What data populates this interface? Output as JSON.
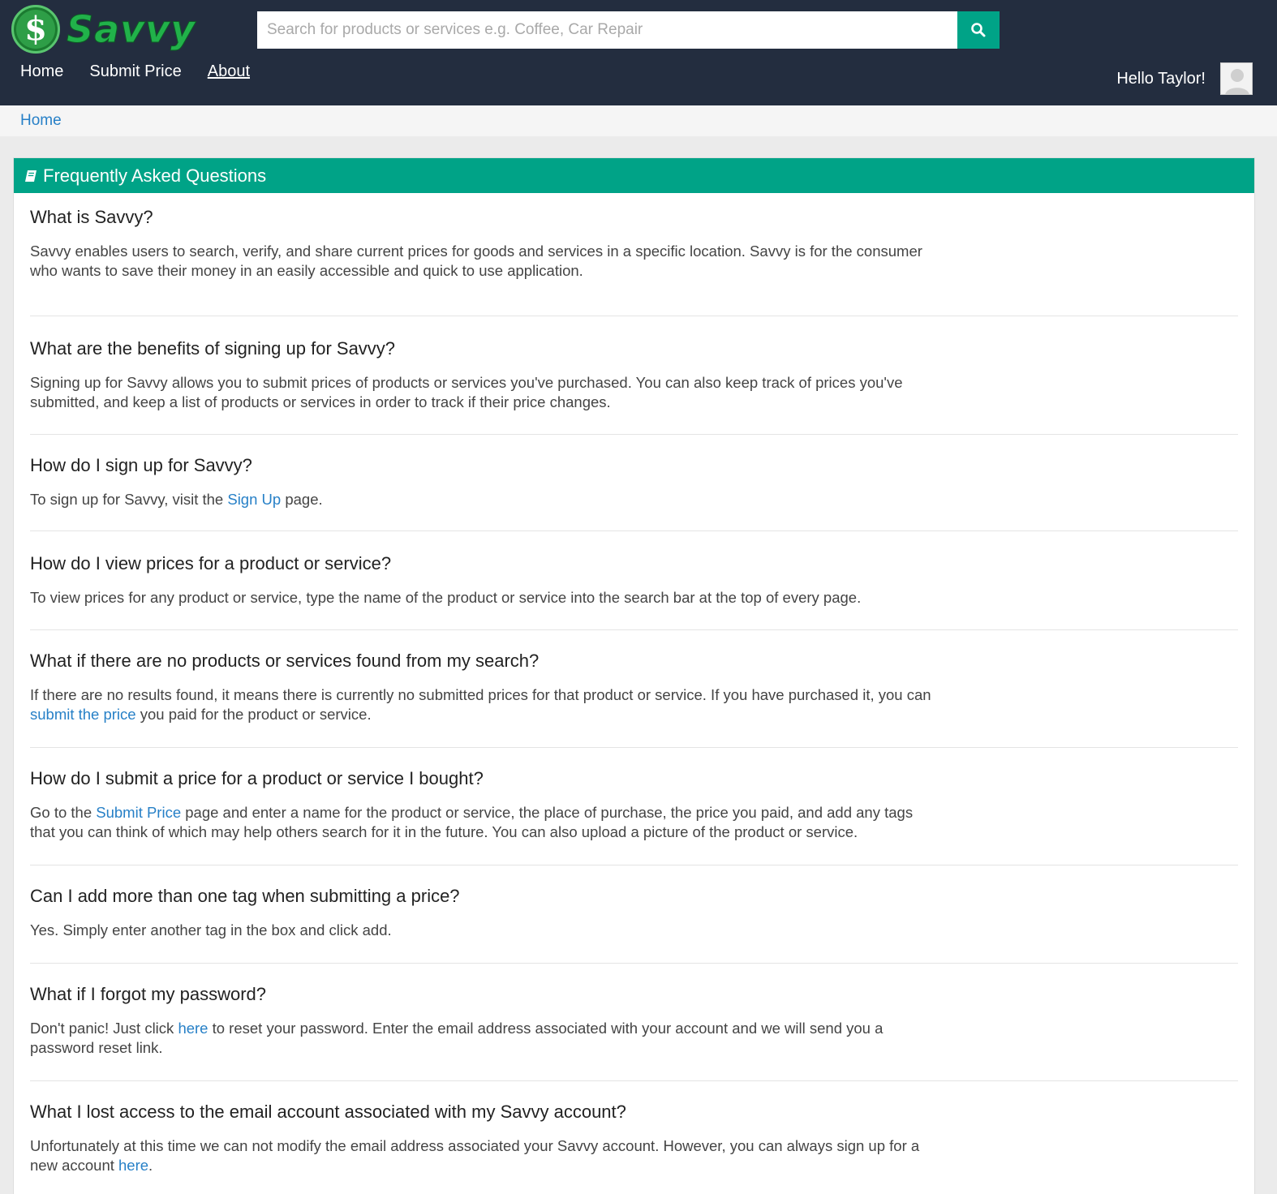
{
  "brand": {
    "name": "Savvy",
    "symbol": "$"
  },
  "search": {
    "placeholder": "Search for products or services e.g. Coffee, Car Repair",
    "button_icon": "search-icon"
  },
  "nav": {
    "items": [
      {
        "label": "Home"
      },
      {
        "label": "Submit Price"
      },
      {
        "label": "About"
      }
    ],
    "active": "About"
  },
  "user": {
    "greeting": "Hello Taylor!",
    "avatar_icon": "user-avatar-icon"
  },
  "breadcrumb": {
    "home": "Home"
  },
  "faq": {
    "title": "Frequently Asked Questions",
    "title_icon": "book-icon",
    "items": [
      {
        "q": "What is Savvy?",
        "a": [
          "Savvy enables users to search, verify, and share current prices for goods and services in a specific location. Savvy is for the consumer who wants to save their money in an easily accessible and quick to use application."
        ]
      },
      {
        "q": "What are the benefits of signing up for Savvy?",
        "a": [
          "Signing up for Savvy allows you to submit prices of products or services you've purchased. You can also keep track of prices you've submitted, and keep a list of products or services in order to track if their price changes."
        ]
      },
      {
        "q": "How do I sign up for Savvy?",
        "a": [
          "To sign up for Savvy, visit the ",
          "page."
        ],
        "link": "Sign Up"
      },
      {
        "q": "How do I view prices for a product or service?",
        "a": [
          "To view prices for any product or service, type the name of the product or service into the search bar at the top of every page."
        ]
      },
      {
        "q": "What if there are no products or services found from my search?",
        "a": [
          "If there are no results found, it means there is currently no submitted prices for that product or service. If you have purchased it, you can ",
          "you paid for the product or service."
        ],
        "link": "submit the price"
      },
      {
        "q": "How do I submit a price for a product or service I bought?",
        "a": [
          "Go to the ",
          "page and enter a name for the product or service, the place of purchase, the price you paid, and add any tags that you can think of which may help others search for it in the future. You can also upload a picture of the product or service."
        ],
        "link": "Submit Price"
      },
      {
        "q": "Can I add more than one tag when submitting a price?",
        "a": [
          "Yes. Simply enter another tag in the box and click add."
        ]
      },
      {
        "q": "What if I forgot my password?",
        "a": [
          "Don't panic! Just click ",
          "to reset your password. Enter the email address associated with your account and we will send you a password reset link."
        ],
        "link": "here"
      },
      {
        "q": "What I lost access to the email account associated with my Savvy account?",
        "a": [
          "Unfortunately at this time we can not modify the email address associated your Savvy account. However, you can always sign up for a new account ",
          "."
        ],
        "link": "here"
      }
    ]
  },
  "colors": {
    "navbar": "#232d3f",
    "accent": "#00a387",
    "link": "#2780c7",
    "logo_green": "#21b24a"
  }
}
